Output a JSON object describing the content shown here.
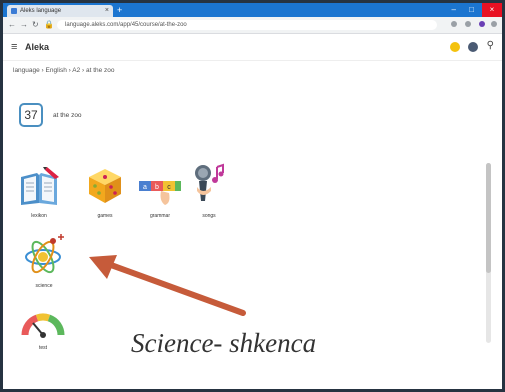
{
  "browser": {
    "tab_title": "Aleks language",
    "close_glyph": "×",
    "newtab_glyph": "+",
    "url": "language.aleks.com/app/45/course/at-the-zoo",
    "window_minimize": "–",
    "window_maximize": "□",
    "window_close": "×"
  },
  "app": {
    "menu_glyph": "≡",
    "brand": "Aleka",
    "account_glyph": "⚲"
  },
  "breadcrumb": "language › English › A2 › at the zoo",
  "lesson": {
    "number": "37",
    "title": "at the zoo"
  },
  "activities": [
    {
      "label": "lexikon",
      "icon": "book-icon"
    },
    {
      "label": "games",
      "icon": "dice-icon"
    },
    {
      "label": "grammar",
      "icon": "grammar-blocks-icon"
    },
    {
      "label": "songs",
      "icon": "microphone-icon"
    },
    {
      "label": "science",
      "icon": "atom-icon"
    },
    {
      "label": "test",
      "icon": "gauge-icon"
    }
  ],
  "annotation": {
    "text": "Science- shkenca",
    "arrow_color": "#c65b3a"
  },
  "colors": {
    "tabstrip": "#1b75d0",
    "frame": "#263341",
    "accent": "#4a8fc0"
  }
}
